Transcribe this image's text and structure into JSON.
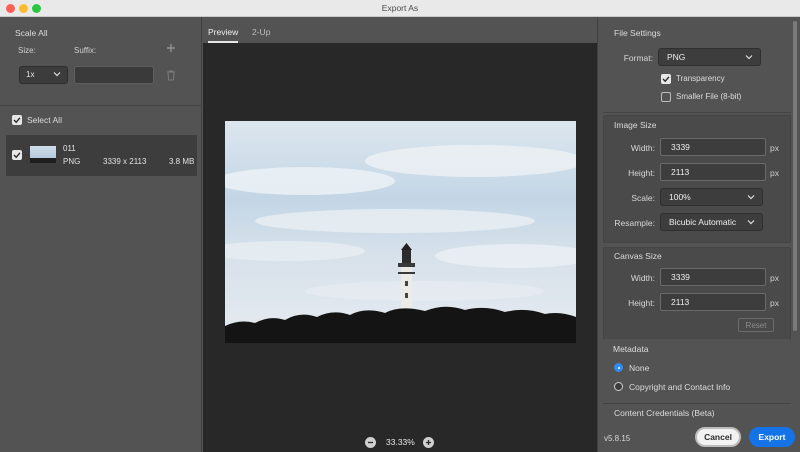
{
  "window": {
    "title": "Export As"
  },
  "left_panel": {
    "scale_all_label": "Scale All",
    "size_label": "Size:",
    "suffix_label": "Suffix:",
    "size_value": "1x",
    "suffix_value": "",
    "select_all_label": "Select All",
    "asset": {
      "name": "011",
      "format": "PNG",
      "dimensions": "3339 x 2113",
      "filesize": "3.8 MB"
    }
  },
  "preview": {
    "tabs": [
      "Preview",
      "2-Up"
    ],
    "zoom": "33.33%"
  },
  "file_settings": {
    "heading": "File Settings",
    "format_label": "Format:",
    "format_value": "PNG",
    "transparency_label": "Transparency",
    "smaller_file_label": "Smaller File (8-bit)"
  },
  "image_size": {
    "heading": "Image Size",
    "width_label": "Width:",
    "width_value": "3339",
    "height_label": "Height:",
    "height_value": "2113",
    "unit": "px",
    "scale_label": "Scale:",
    "scale_value": "100%",
    "resample_label": "Resample:",
    "resample_value": "Bicubic Automatic"
  },
  "canvas_size": {
    "heading": "Canvas Size",
    "width_label": "Width:",
    "width_value": "3339",
    "height_label": "Height:",
    "height_value": "2113",
    "unit": "px",
    "reset_label": "Reset"
  },
  "metadata": {
    "heading": "Metadata",
    "options": [
      "None",
      "Copyright and Contact Info"
    ],
    "selected": "None"
  },
  "content_credentials": {
    "heading": "Content Credentials (Beta)"
  },
  "footer": {
    "version": "v5.8.15",
    "cancel_label": "Cancel",
    "export_label": "Export"
  },
  "colors": {
    "accent": "#1473e6",
    "radio_selected": "#2f8cf0",
    "panel_bg": "#535353",
    "canvas_bg": "#282828"
  },
  "icons": [
    "add-icon",
    "trash-icon",
    "chevron-down-icon",
    "checkmark-icon",
    "zoom-out-icon",
    "zoom-in-icon"
  ]
}
